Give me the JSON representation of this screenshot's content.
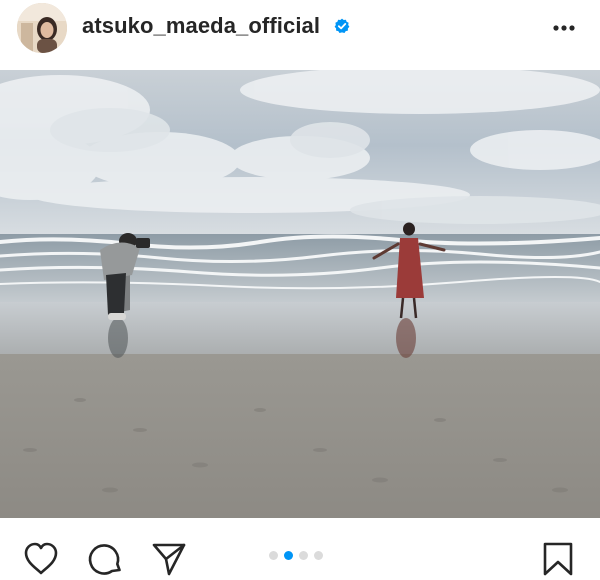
{
  "header": {
    "username": "atsuko_maeda_official",
    "avatar_icon": "profile-avatar",
    "verified_icon": "verified-badge-icon",
    "more_icon": "more-options-icon"
  },
  "post": {
    "image_label": "post-photo",
    "carousel": {
      "count": 4,
      "active_index": 1
    }
  },
  "actions": {
    "like_icon": "heart-icon",
    "comment_icon": "comment-icon",
    "share_icon": "send-icon",
    "save_icon": "bookmark-icon"
  },
  "colors": {
    "accent": "#0095f6",
    "verified": "#0095f6",
    "text": "#262626",
    "dot_inactive": "#dbdbdb"
  }
}
